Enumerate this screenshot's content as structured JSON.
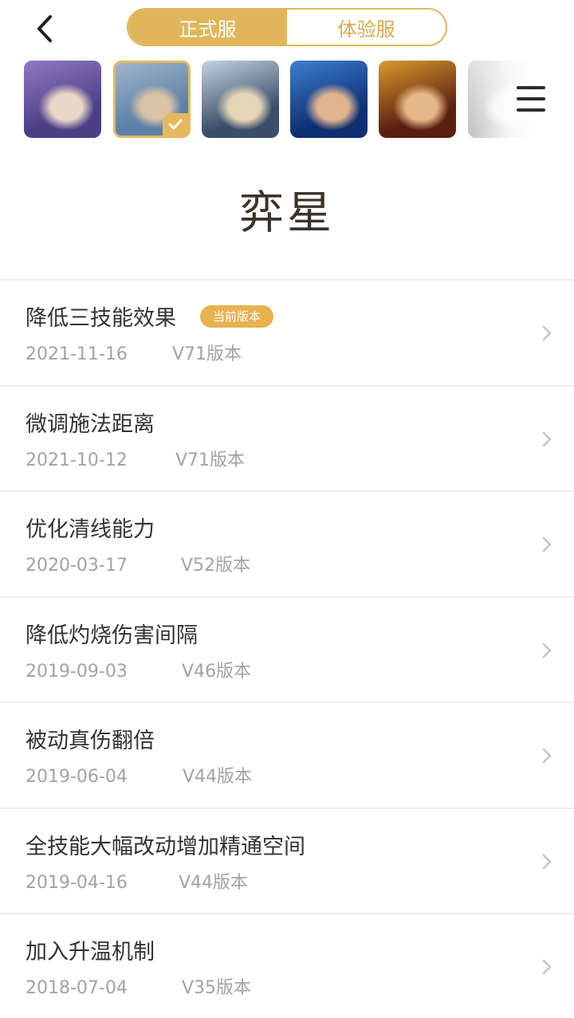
{
  "tabs": [
    {
      "label": "正式服",
      "active": true
    },
    {
      "label": "体验服",
      "active": false
    }
  ],
  "accent_color": "#e1b65a",
  "heroes": [
    {
      "name": "hero-portrait-1",
      "colors": [
        "#4b3e86",
        "#8f7ac2",
        "#e9d7c7"
      ],
      "selected": false
    },
    {
      "name": "hero-portrait-2",
      "colors": [
        "#5b7fa6",
        "#9fb5c8",
        "#d9c3a7"
      ],
      "selected": true
    },
    {
      "name": "hero-portrait-3",
      "colors": [
        "#3b4d6b",
        "#c5d3e0",
        "#e6d6b8"
      ],
      "selected": false
    },
    {
      "name": "hero-portrait-4",
      "colors": [
        "#0f2f73",
        "#3d7fd0",
        "#e0b48f"
      ],
      "selected": false
    },
    {
      "name": "hero-portrait-5",
      "colors": [
        "#5b1f12",
        "#d99a2b",
        "#e6b888"
      ],
      "selected": false
    },
    {
      "name": "hero-portrait-6",
      "colors": [
        "#bfbfbf",
        "#dedede",
        "#f2f2f2"
      ],
      "selected": false
    }
  ],
  "hero_name": "弈星",
  "changes": [
    {
      "title": "降低三技能效果",
      "badge": "当前版本",
      "date": "2021-11-16",
      "version": "V71版本"
    },
    {
      "title": "微调施法距离",
      "badge": "",
      "date": "2021-10-12",
      "version": "V71版本"
    },
    {
      "title": "优化清线能力",
      "badge": "",
      "date": "2020-03-17",
      "version": "V52版本"
    },
    {
      "title": "降低灼烧伤害间隔",
      "badge": "",
      "date": "2019-09-03",
      "version": "V46版本"
    },
    {
      "title": "被动真伤翻倍",
      "badge": "",
      "date": "2019-06-04",
      "version": "V44版本"
    },
    {
      "title": "全技能大幅改动增加精通空间",
      "badge": "",
      "date": "2019-04-16",
      "version": "V44版本"
    },
    {
      "title": "加入升温机制",
      "badge": "",
      "date": "2018-07-04",
      "version": "V35版本"
    }
  ]
}
